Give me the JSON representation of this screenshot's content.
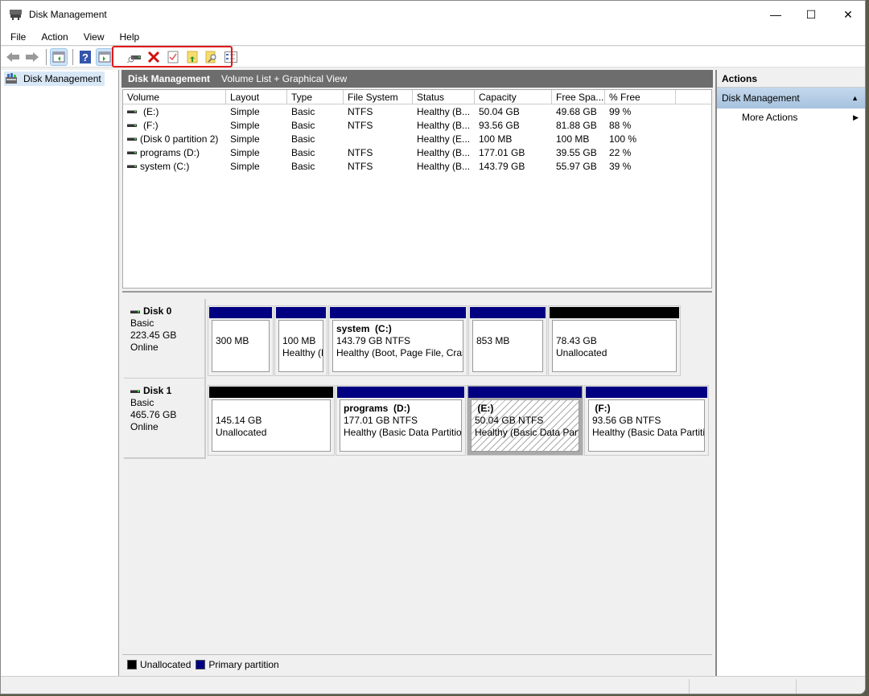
{
  "window": {
    "title": "Disk Management",
    "controls": {
      "minimize": "—",
      "maximize": "☐",
      "close": "✕"
    }
  },
  "menu": [
    "File",
    "Action",
    "View",
    "Help"
  ],
  "toolbar": {
    "buttons": [
      "back-icon",
      "forward-icon",
      "show-hide-console-tree-icon",
      "help-icon",
      "show-hide-action-pane-icon",
      "connect-disk-icon",
      "delete-icon",
      "properties-check-icon",
      "folder-up-icon",
      "folder-search-icon",
      "settings-list-icon"
    ]
  },
  "tree": {
    "root": "Disk Management"
  },
  "center": {
    "title": "Disk Management",
    "subtitle": "Volume List + Graphical View"
  },
  "volume_list": {
    "columns": [
      "Volume",
      "Layout",
      "Type",
      "File System",
      "Status",
      "Capacity",
      "Free Spa...",
      "% Free"
    ],
    "rows": [
      [
        "(E:)",
        "Simple",
        "Basic",
        "NTFS",
        "Healthy (B...",
        "50.04 GB",
        "49.68 GB",
        "99 %"
      ],
      [
        "(F:)",
        "Simple",
        "Basic",
        "NTFS",
        "Healthy (B...",
        "93.56 GB",
        "81.88 GB",
        "88 %"
      ],
      [
        "(Disk 0 partition 2)",
        "Simple",
        "Basic",
        "",
        "Healthy (E...",
        "100 MB",
        "100 MB",
        "100 %"
      ],
      [
        "programs (D:)",
        "Simple",
        "Basic",
        "NTFS",
        "Healthy (B...",
        "177.01 GB",
        "39.55 GB",
        "22 %"
      ],
      [
        "system (C:)",
        "Simple",
        "Basic",
        "NTFS",
        "Healthy (B...",
        "143.79 GB",
        "55.97 GB",
        "39 %"
      ]
    ]
  },
  "disks": [
    {
      "name": "Disk 0",
      "type": "Basic",
      "size": "223.45 GB",
      "status": "Online",
      "partitions": [
        {
          "kind": "primary",
          "name": "",
          "line1": "300 MB",
          "line2": ""
        },
        {
          "kind": "primary",
          "name": "",
          "line1": "100 MB",
          "line2": "Healthy (E"
        },
        {
          "kind": "primary",
          "name": "system  (C:)",
          "line1": "143.79 GB NTFS",
          "line2": "Healthy (Boot, Page File, Crash"
        },
        {
          "kind": "primary",
          "name": "",
          "line1": "853 MB",
          "line2": ""
        },
        {
          "kind": "unallocated",
          "name": "",
          "line1": "78.43 GB",
          "line2": "Unallocated"
        }
      ]
    },
    {
      "name": "Disk 1",
      "type": "Basic",
      "size": "465.76 GB",
      "status": "Online",
      "partitions": [
        {
          "kind": "unallocated",
          "name": "",
          "line1": "145.14 GB",
          "line2": "Unallocated"
        },
        {
          "kind": "primary",
          "name": "programs  (D:)",
          "line1": "177.01 GB NTFS",
          "line2": "Healthy (Basic Data Partition"
        },
        {
          "kind": "primary",
          "name": " (E:)",
          "line1": "50.04 GB NTFS",
          "line2": "Healthy (Basic Data Partiti",
          "selected": true
        },
        {
          "kind": "primary",
          "name": " (F:)",
          "line1": "93.56 GB NTFS",
          "line2": "Healthy (Basic Data Partitic"
        }
      ]
    }
  ],
  "legend": [
    {
      "label": "Unallocated",
      "color": "#000000"
    },
    {
      "label": "Primary partition",
      "color": "#000080"
    }
  ],
  "actions": {
    "header": "Actions",
    "section": "Disk Management",
    "items": [
      "More Actions"
    ]
  },
  "colors": {
    "primary": "#000080",
    "unallocated": "#000000",
    "highlight": "#e0191b"
  }
}
